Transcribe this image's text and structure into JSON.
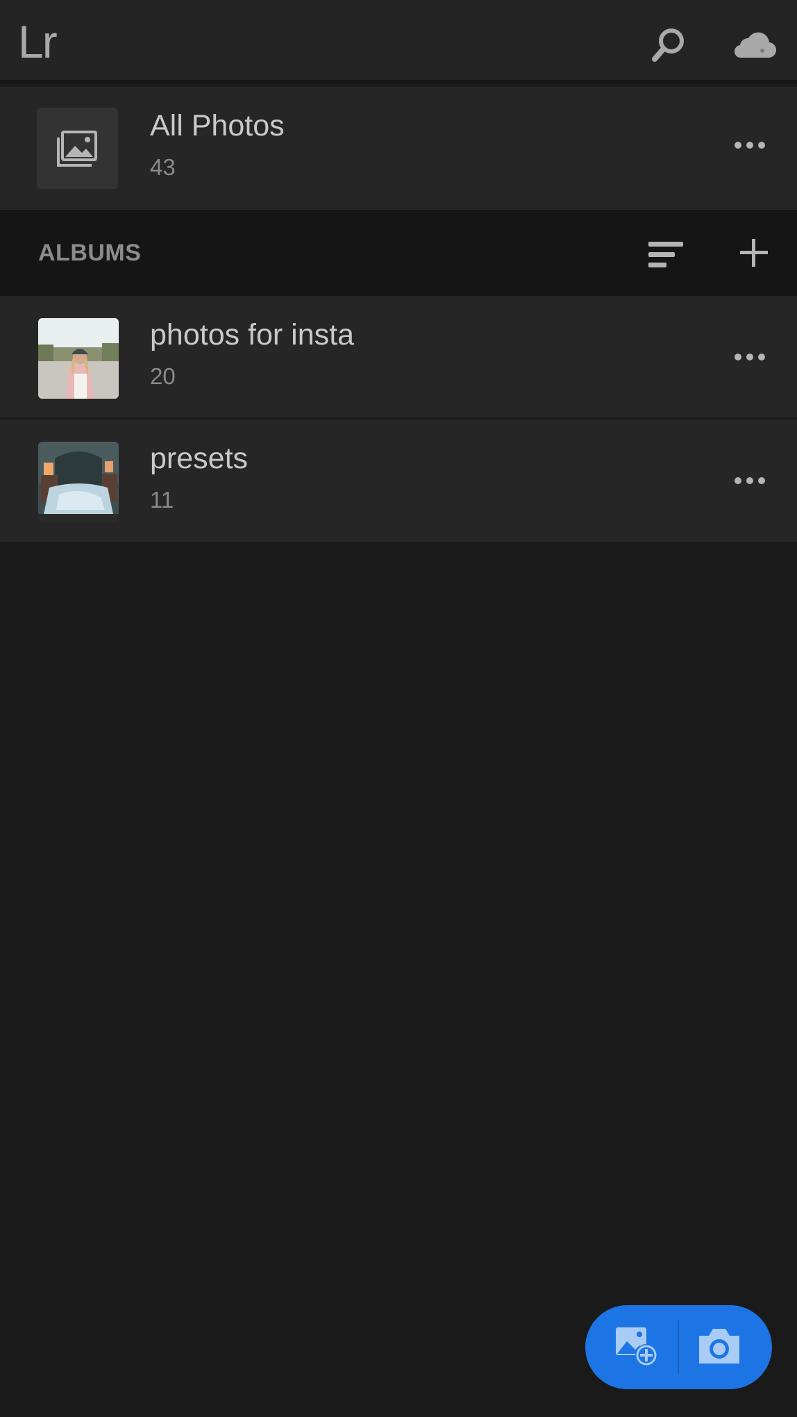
{
  "header": {
    "logo": "Lr",
    "icons": [
      "search-icon",
      "cloud-icon"
    ]
  },
  "all_photos": {
    "title": "All Photos",
    "count": "43",
    "icon": "photos-stack-icon"
  },
  "albums": {
    "section_label": "ALBUMS",
    "sort_icon": "sort-icon",
    "add_icon": "plus-icon",
    "items": [
      {
        "title": "photos for insta",
        "count": "20"
      },
      {
        "title": "presets",
        "count": "11"
      }
    ]
  },
  "fab": {
    "icons": [
      "add-photo-icon",
      "camera-icon"
    ],
    "color": "#1d74e4"
  },
  "colors": {
    "background": "#1a1a1a",
    "header": "#242424",
    "row": "#262626",
    "section_header": "#151515",
    "accent": "#1d74e4"
  }
}
